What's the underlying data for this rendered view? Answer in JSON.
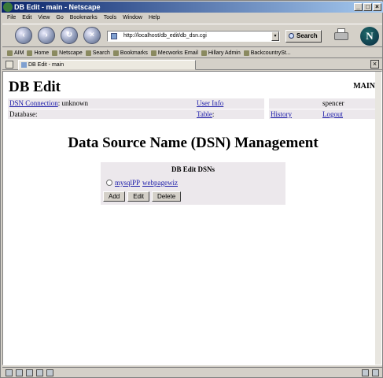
{
  "window": {
    "title": "DB Edit - main - Netscape",
    "buttons": [
      "_",
      "□",
      "×"
    ]
  },
  "menu": {
    "items": [
      "File",
      "Edit",
      "View",
      "Go",
      "Bookmarks",
      "Tools",
      "Window",
      "Help"
    ]
  },
  "navbar": {
    "url": "http://localhost/db_edit/db_dsn.cgi",
    "search_label": "Search",
    "logo": "N"
  },
  "personal_toolbar": {
    "items": [
      "AIM",
      "Home",
      "Netscape",
      "Search",
      "Bookmarks",
      "Mecworks Email",
      "Hillary Admin",
      "BackcountrySt..."
    ]
  },
  "tab": {
    "label": "DB Edit - main",
    "close": "×"
  },
  "page": {
    "title": "DB Edit",
    "section_label": "MAIN",
    "header": {
      "dsn_connection_label": "DSN Connection",
      "dsn_connection_value": ": unknown",
      "user_info_label": "User Info",
      "user_value": "spencer",
      "database_label": "Database:",
      "table_label": "Table",
      "table_suffix": ":",
      "history_label": "History",
      "logout_label": "Logout"
    },
    "heading": "Data Source Name (DSN) Management",
    "dsn_box": {
      "title": "DB Edit DSNs",
      "dsn_links": [
        "mysqlPP",
        "webpagewiz"
      ],
      "buttons": {
        "add": "Add",
        "edit": "Edit",
        "delete": "Delete"
      }
    }
  }
}
